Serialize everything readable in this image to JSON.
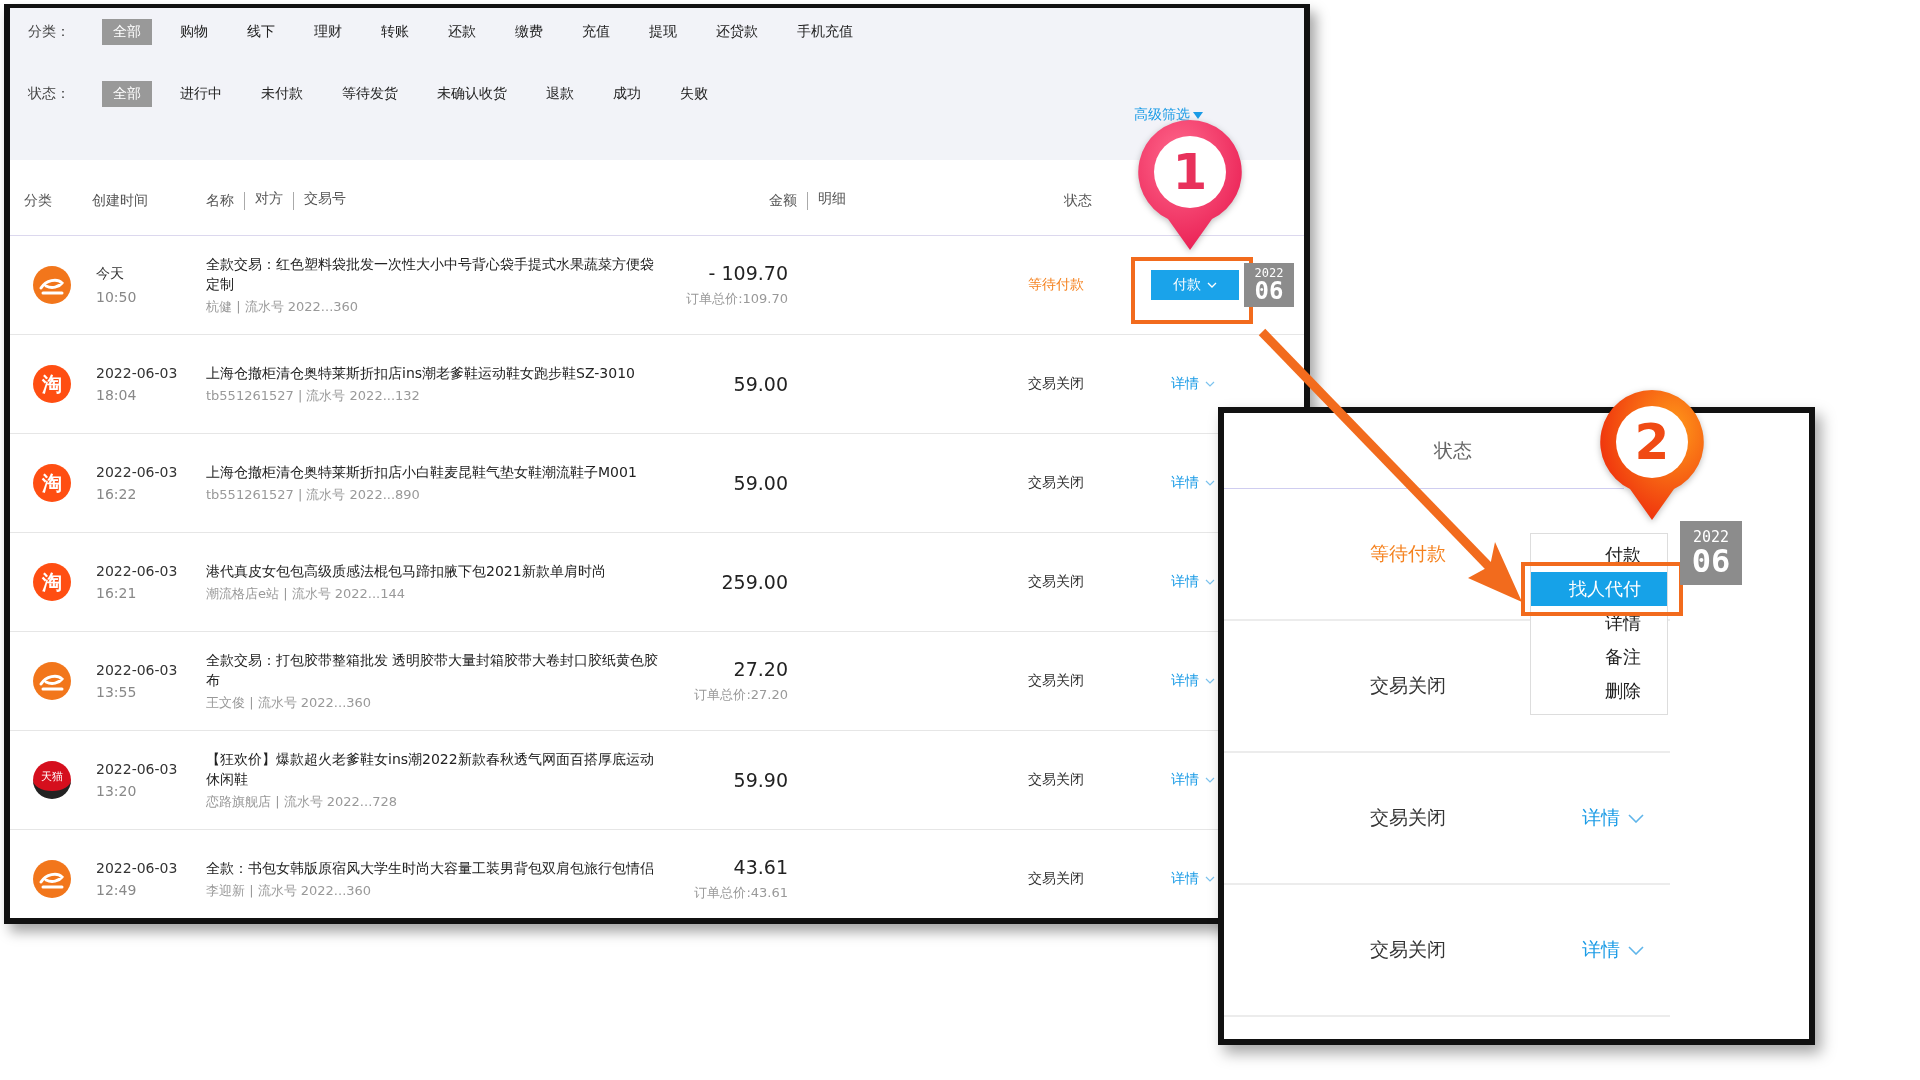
{
  "filters": {
    "category": {
      "label": "分类：",
      "options": [
        {
          "label": "全部",
          "selected": true
        },
        {
          "label": "购物",
          "selected": false
        },
        {
          "label": "线下",
          "selected": false
        },
        {
          "label": "理财",
          "selected": false
        },
        {
          "label": "转账",
          "selected": false
        },
        {
          "label": "还款",
          "selected": false
        },
        {
          "label": "缴费",
          "selected": false
        },
        {
          "label": "充值",
          "selected": false
        },
        {
          "label": "提现",
          "selected": false
        },
        {
          "label": "还贷款",
          "selected": false
        },
        {
          "label": "手机充值",
          "selected": false
        }
      ]
    },
    "status": {
      "label": "状态：",
      "options": [
        {
          "label": "全部",
          "selected": true
        },
        {
          "label": "进行中",
          "selected": false
        },
        {
          "label": "未付款",
          "selected": false
        },
        {
          "label": "等待发货",
          "selected": false
        },
        {
          "label": "未确认收货",
          "selected": false
        },
        {
          "label": "退款",
          "selected": false
        },
        {
          "label": "成功",
          "selected": false
        },
        {
          "label": "失败",
          "selected": false
        }
      ]
    },
    "advanced": "高级筛选"
  },
  "table": {
    "header": {
      "category": "分类",
      "created": "创建时间",
      "name_fields": [
        "名称",
        "对方",
        "交易号"
      ],
      "amount_fields": [
        "金额",
        "明细"
      ],
      "status": "状态"
    },
    "rows": [
      {
        "kind": "alipay",
        "date": "今天",
        "time": "10:50",
        "name": "全款交易：红色塑料袋批发一次性大小中号背心袋手提式水果蔬菜方便袋定制",
        "meta": "杭健 | 流水号 2022...360",
        "amount": "- 109.70",
        "total": "订单总价:109.70",
        "status": "等待付款",
        "color": "#f5821f",
        "action": {
          "kind": "button",
          "label": "付款",
          "framed": true
        },
        "badge": {
          "year": "2022",
          "month": "06"
        }
      },
      {
        "kind": "taobao",
        "logo_text": "淘",
        "date": "2022-06-03",
        "time": "18:04",
        "name": "上海仓撤柜清仓奥特莱斯折扣店ins潮老爹鞋运动鞋女跑步鞋SZ-3010",
        "meta": "tb551261527 | 流水号 2022...132",
        "amount": "59.00",
        "status": "交易关闭",
        "color": "#333333",
        "action": {
          "kind": "link",
          "label": "详情",
          "framed": false
        }
      },
      {
        "kind": "taobao",
        "logo_text": "淘",
        "date": "2022-06-03",
        "time": "16:22",
        "name": "上海仓撤柜清仓奥特莱斯折扣店小白鞋麦昆鞋气垫女鞋潮流鞋子M001",
        "meta": "tb551261527 | 流水号 2022...890",
        "amount": "59.00",
        "status": "交易关闭",
        "color": "#333333",
        "action": {
          "kind": "link",
          "label": "详情",
          "framed": false
        }
      },
      {
        "kind": "taobao",
        "logo_text": "淘",
        "date": "2022-06-03",
        "time": "16:21",
        "name": "港代真皮女包包高级质感法棍包马蹄扣腋下包2021新款单肩时尚",
        "meta": "潮流格店e站 | 流水号 2022...144",
        "amount": "259.00",
        "status": "交易关闭",
        "color": "#333333",
        "action": {
          "kind": "link",
          "label": "详情",
          "framed": false
        }
      },
      {
        "kind": "alipay",
        "date": "2022-06-03",
        "time": "13:55",
        "name": "全款交易：打包胶带整箱批发 透明胶带大量封箱胶带大卷封口胶纸黄色胶布",
        "meta": "王文俊 | 流水号 2022...360",
        "amount": "27.20",
        "total": "订单总价:27.20",
        "status": "交易关闭",
        "color": "#333333",
        "action": {
          "kind": "link",
          "label": "详情",
          "framed": false
        }
      },
      {
        "kind": "tmall",
        "logo_text": "天猫",
        "date": "2022-06-03",
        "time": "13:20",
        "name": "【狂欢价】爆款超火老爹鞋女ins潮2022新款春秋透气网面百搭厚底运动休闲鞋",
        "meta": "恋路旗舰店 | 流水号 2022...728",
        "amount": "59.90",
        "status": "交易关闭",
        "color": "#333333",
        "action": {
          "kind": "link",
          "label": "详情",
          "framed": false
        }
      },
      {
        "kind": "alipay",
        "date": "2022-06-03",
        "time": "12:49",
        "name": "全款：书包女韩版原宿风大学生时尚大容量工装男背包双肩包旅行包情侣",
        "meta": "李迎新 | 流水号 2022...360",
        "amount": "43.61",
        "total": "订单总价:43.61",
        "status": "交易关闭",
        "color": "#333333",
        "action": {
          "kind": "link",
          "label": "详情",
          "framed": false
        }
      }
    ]
  },
  "markers": [
    {
      "number": "1"
    },
    {
      "number": "2"
    }
  ],
  "inset": {
    "header": "状态",
    "rows": [
      {
        "status": "等待付款",
        "color": "#f5821f"
      },
      {
        "status": "交易关闭",
        "color": "#333333"
      },
      {
        "status": "交易关闭",
        "color": "#333333",
        "action": "详情"
      },
      {
        "status": "交易关闭",
        "color": "#333333",
        "action": "详情"
      }
    ],
    "menu": {
      "items": [
        {
          "label": "付款",
          "selected": false
        },
        {
          "label": "找人代付",
          "selected": true
        },
        {
          "label": "详情",
          "selected": false
        },
        {
          "label": "备注",
          "selected": false
        },
        {
          "label": "删除",
          "selected": false
        }
      ]
    },
    "badge": {
      "year": "2022",
      "month": "06"
    }
  }
}
